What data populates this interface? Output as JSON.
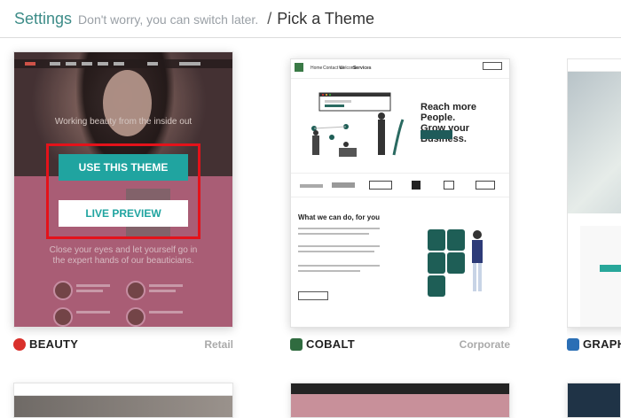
{
  "breadcrumb": {
    "settings": "Settings",
    "subtitle": "Don't worry, you can switch later.",
    "separator": "/",
    "page": "Pick a Theme"
  },
  "themes": [
    {
      "name": "BEAUTY",
      "category": "Retail",
      "icon": "beauty-logo-icon",
      "icon_color": "#d9302b",
      "preview": {
        "tagline": "Working beauty from the inside out",
        "text_line1": "Close your eyes and let yourself go in",
        "text_line2": "the expert hands of our beauticians."
      },
      "actions": {
        "use": "USE THIS THEME",
        "preview": "LIVE PREVIEW"
      }
    },
    {
      "name": "COBALT",
      "category": "Corporate",
      "icon": "cobalt-logo-icon",
      "icon_color": "#2f6b3f",
      "preview": {
        "nav": [
          "Home",
          "Contact us",
          "Welcome",
          "Services"
        ],
        "hero_line1": "Reach more People.",
        "hero_line2": "Grow your Business.",
        "section_title": "What we can do, for you"
      }
    },
    {
      "name": "GRAPH",
      "category": "",
      "icon": "graph-logo-icon",
      "icon_color": "#2b6fb5"
    }
  ],
  "colors": {
    "accent": "#20a4a0",
    "selection": "#e4121a",
    "breadcrumb": "#3d8c88"
  }
}
